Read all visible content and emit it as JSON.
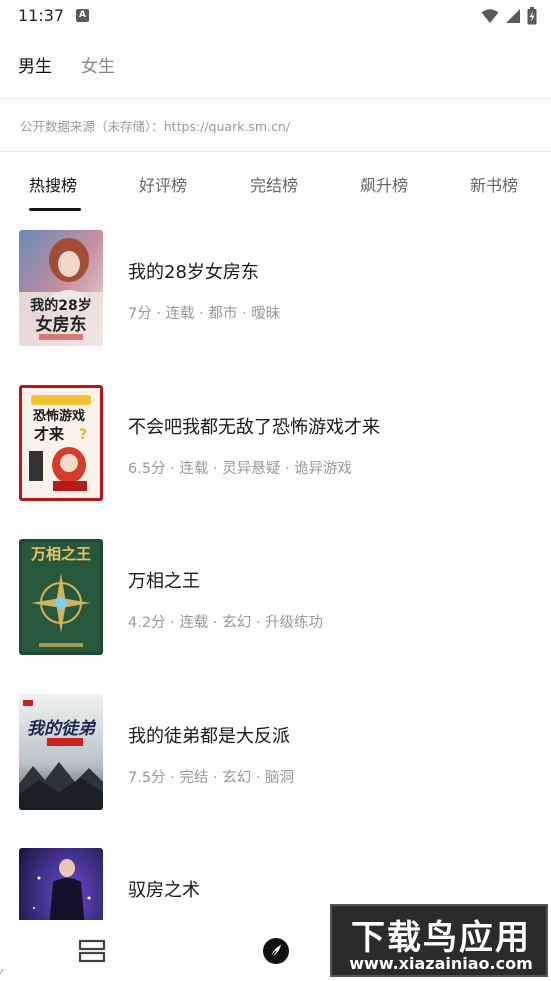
{
  "status_bar": {
    "time": "11:37",
    "notification_badge": "A"
  },
  "gender_tabs": [
    {
      "label": "男生",
      "active": true
    },
    {
      "label": "女生",
      "active": false
    }
  ],
  "source_line": "公开数据来源（未存储）：https://quark.sm.cn/",
  "rank_tabs": [
    {
      "label": "热搜榜",
      "active": true
    },
    {
      "label": "好评榜",
      "active": false
    },
    {
      "label": "完结榜",
      "active": false
    },
    {
      "label": "飙升榜",
      "active": false
    },
    {
      "label": "新书榜",
      "active": false
    }
  ],
  "books": [
    {
      "title": "我的28岁女房东",
      "meta": "7分 · 连载 · 都市 · 暧昧",
      "cover_text": "我的28岁女房东"
    },
    {
      "title": "不会吧我都无敌了恐怖游戏才来",
      "meta": "6.5分 · 连载 · 灵异悬疑 · 诡异游戏",
      "cover_text": "恐怖游戏才来"
    },
    {
      "title": "万相之王",
      "meta": "4.2分 · 连载 · 玄幻 · 升级练功",
      "cover_text": "万相之王"
    },
    {
      "title": "我的徒弟都是大反派",
      "meta": "7.5分 · 完结 · 玄幻 · 脑洞",
      "cover_text": "我的徒弟"
    },
    {
      "title": "驭房之术",
      "meta": "",
      "cover_text": ""
    }
  ],
  "bottom_nav": [
    {
      "icon": "bookshelf-icon"
    },
    {
      "icon": "compass-icon"
    }
  ],
  "watermark": {
    "main": "下载鸟应用",
    "url": "www.xiazainiao.com"
  },
  "colors": {
    "active_text": "#111111",
    "inactive_text": "#888888",
    "meta_text": "#999999",
    "divider": "#ececec"
  }
}
